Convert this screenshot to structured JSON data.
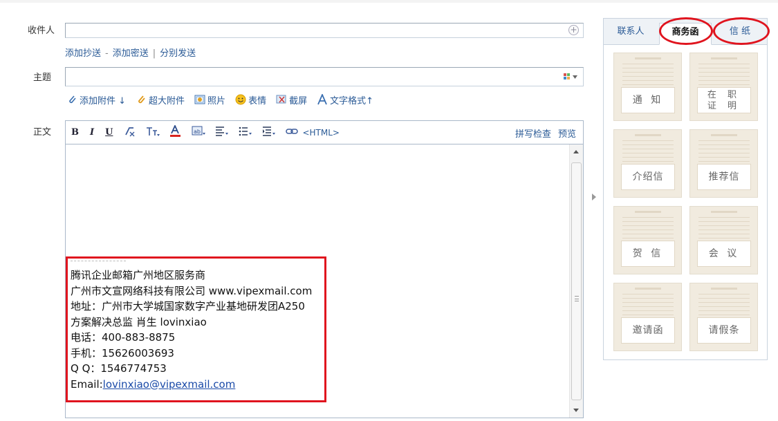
{
  "compose": {
    "recipient_label": "收件人",
    "recipient_value": "",
    "add_icon": "plus-circle-icon",
    "add_cc": "添加抄送",
    "add_bcc": "添加密送",
    "separate_send": "分别发送",
    "link_sep1": "-",
    "link_sep2": "|",
    "subject_label": "主题",
    "subject_value": "",
    "body_label": "正文"
  },
  "attachments": {
    "add_attachment": "添加附件 ↓",
    "large_attachment": "超大附件",
    "photo": "照片",
    "emoji": "表情",
    "screenshot": "截屏",
    "text_format": "文字格式↑"
  },
  "editor_toolbar": {
    "bold": "B",
    "italic": "I",
    "underline": "U",
    "html": "<HTML>",
    "spellcheck": "拼写检查",
    "preview": "预览"
  },
  "signature": {
    "lines": [
      "腾讯企业邮箱广州地区服务商",
      "广州市文宣网络科技有限公司 www.vipexmail.com",
      "地址：广州市大学城国家数字产业基地研发团A250",
      "方案解决总监 肖生 lovinxiao",
      "电话：400-883-8875",
      "手机：15626003693",
      "Q Q：1546774753"
    ],
    "email_prefix": "Email:",
    "email": "lovinxiao@vipexmail.com"
  },
  "side_panel": {
    "tabs": [
      "联系人",
      "商务函",
      "信 纸"
    ],
    "active_tab": "商务函",
    "cards": [
      "通 知",
      "在 职 证 明",
      "介绍信",
      "推荐信",
      "贺 信",
      "会 议",
      "邀请函",
      "请假条"
    ]
  },
  "colors": {
    "link": "#2a5a96",
    "highlight_red": "#e0141e",
    "card_bg": "#f1ebdf"
  }
}
